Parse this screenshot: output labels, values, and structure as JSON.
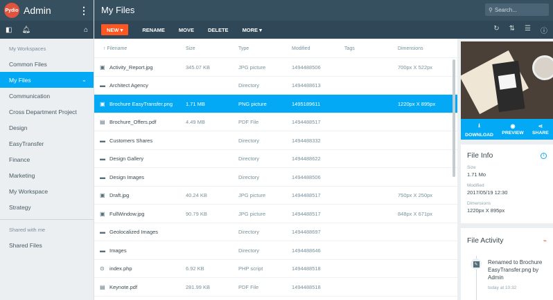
{
  "app": {
    "logo_text": "Pydio",
    "title": "Admin"
  },
  "sidebar": {
    "workspaces_header": "My Workspaces",
    "items": [
      {
        "label": "Common Files"
      },
      {
        "label": "My Files",
        "active": true
      },
      {
        "label": "Communication"
      },
      {
        "label": "Cross Department Project"
      },
      {
        "label": "Design"
      },
      {
        "label": "EasyTransfer"
      },
      {
        "label": "Finance"
      },
      {
        "label": "Marketing"
      },
      {
        "label": "My Workspace"
      },
      {
        "label": "Strategy"
      }
    ],
    "shared_header": "Shared with me",
    "shared_items": [
      {
        "label": "Shared Files"
      }
    ]
  },
  "header": {
    "title": "My Files",
    "search_placeholder": "Search..."
  },
  "toolbar": {
    "new_label": "NEW",
    "rename_label": "RENAME",
    "move_label": "MOVE",
    "delete_label": "DELETE",
    "more_label": "MORE"
  },
  "table": {
    "columns": {
      "name": "Filename",
      "size": "Size",
      "type": "Type",
      "modified": "Modified",
      "tags": "Tags",
      "dimensions": "Dimensions"
    },
    "rows": [
      {
        "icon": "image-file-icon",
        "name": "Activity_Report.jpg",
        "size": "345.07 KB",
        "type": "JPG picture",
        "modified": "1494488506",
        "tags": "",
        "dim": "700px X 522px"
      },
      {
        "icon": "folder-icon",
        "name": "Architect Agency",
        "size": "",
        "type": "Directory",
        "modified": "1494488613",
        "tags": "",
        "dim": ""
      },
      {
        "icon": "image-file-icon",
        "name": "Brochure EasyTransfer.png",
        "size": "1.71 MB",
        "type": "PNG picture",
        "modified": "1495189611",
        "tags": "",
        "dim": "1220px X 895px",
        "selected": true
      },
      {
        "icon": "pdf-file-icon",
        "name": "Brochure_Offers.pdf",
        "size": "4.49 MB",
        "type": "PDF File",
        "modified": "1494488517",
        "tags": "",
        "dim": ""
      },
      {
        "icon": "folder-icon",
        "name": "Customers Shares",
        "size": "",
        "type": "Directory",
        "modified": "1494488332",
        "tags": "",
        "dim": ""
      },
      {
        "icon": "folder-icon",
        "name": "Design Gallery",
        "size": "",
        "type": "Directory",
        "modified": "1494488622",
        "tags": "",
        "dim": ""
      },
      {
        "icon": "folder-icon",
        "name": "Design Images",
        "size": "",
        "type": "Directory",
        "modified": "1494488506",
        "tags": "",
        "dim": ""
      },
      {
        "icon": "image-file-icon",
        "name": "Draft.jpg",
        "size": "40.24 KB",
        "type": "JPG picture",
        "modified": "1494488517",
        "tags": "",
        "dim": "750px X 250px"
      },
      {
        "icon": "image-file-icon",
        "name": "FullWindow.jpg",
        "size": "90.79 KB",
        "type": "JPG picture",
        "modified": "1494488517",
        "tags": "",
        "dim": "848px X 671px"
      },
      {
        "icon": "folder-icon",
        "name": "Geolocalized Images",
        "size": "",
        "type": "Directory",
        "modified": "1494488697",
        "tags": "",
        "dim": ""
      },
      {
        "icon": "folder-icon",
        "name": "Images",
        "size": "",
        "type": "Directory",
        "modified": "1494488646",
        "tags": "",
        "dim": ""
      },
      {
        "icon": "code-file-icon",
        "name": "index.php",
        "size": "6.92 KB",
        "type": "PHP script",
        "modified": "1494488518",
        "tags": "",
        "dim": ""
      },
      {
        "icon": "pdf-file-icon",
        "name": "Keynote.pdf",
        "size": "281.99 KB",
        "type": "PDF File",
        "modified": "1494488518",
        "tags": "",
        "dim": ""
      }
    ]
  },
  "preview": {
    "download_label": "DOWNLOAD",
    "preview_label": "PREVIEW",
    "share_label": "SHARE"
  },
  "file_info": {
    "title": "File Info",
    "size_label": "Size",
    "size_value": "1.71 Mo",
    "modified_label": "Modified",
    "modified_value": "2017/05/19 12:30",
    "dimensions_label": "Dimensions",
    "dimensions_value": "1220px X 895px"
  },
  "activity": {
    "title": "File Activity",
    "event_text": "Renamed to Brochure EasyTransfer.png by Admin",
    "event_time": "today at 10:32"
  },
  "colors": {
    "accent": "#03a9f4",
    "primary_dark": "#37505f",
    "new_button": "#ff5722"
  }
}
